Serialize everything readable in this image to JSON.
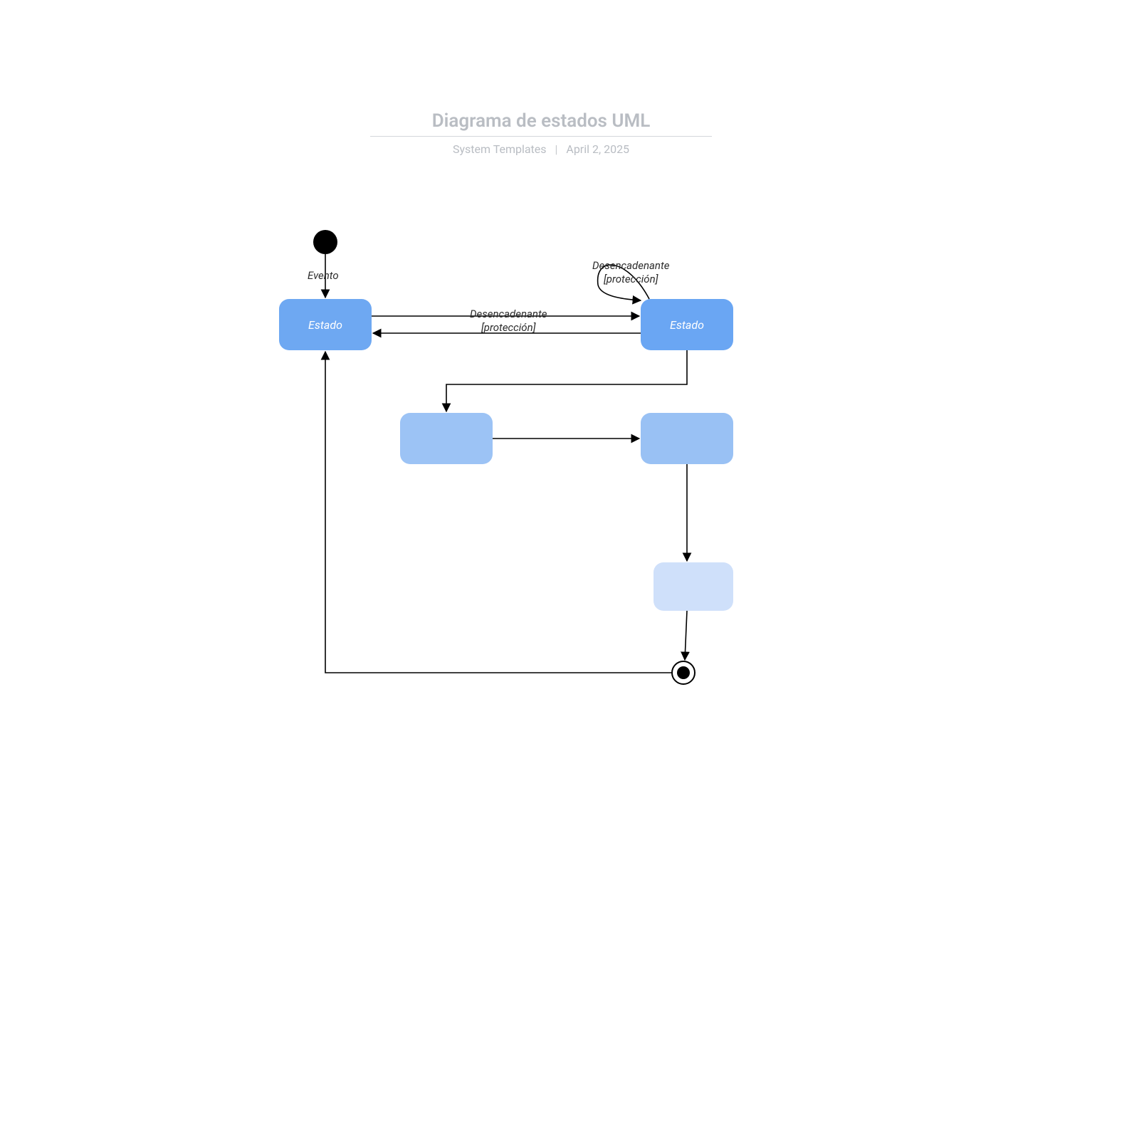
{
  "header": {
    "title": "Diagrama de estados UML",
    "author": "System Templates",
    "date": "April 2, 2025"
  },
  "nodes": {
    "initial": {
      "type": "initial"
    },
    "final": {
      "type": "final"
    },
    "state1": {
      "label": "Estado"
    },
    "state2": {
      "label": "Estado"
    },
    "state3": {
      "label": ""
    },
    "state4": {
      "label": ""
    },
    "state5": {
      "label": ""
    }
  },
  "edges": {
    "e_initial_state1": {
      "label": "Evento"
    },
    "e_state1_state2": {
      "label_line1": "Desencadenante",
      "label_line2": "[protección]"
    },
    "e_state2_state1": {
      "label": ""
    },
    "e_state2_self": {
      "label_line1": "Desencadenante",
      "label_line2": "[protección]"
    },
    "e_state2_state3": {
      "label": ""
    },
    "e_state3_state4": {
      "label": ""
    },
    "e_state4_state5": {
      "label": ""
    },
    "e_state5_final": {
      "label": ""
    },
    "e_final_state1": {
      "label": ""
    }
  }
}
